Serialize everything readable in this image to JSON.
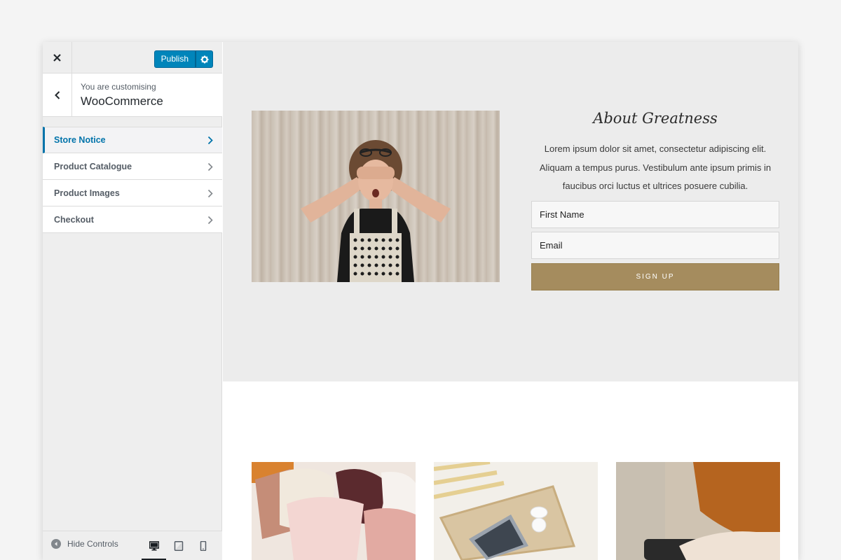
{
  "customizer": {
    "publish_label": "Publish",
    "customizing_label": "You are customising",
    "customizing_title": "WooCommerce",
    "menu": [
      {
        "label": "Store Notice",
        "active": true
      },
      {
        "label": "Product Catalogue",
        "active": false
      },
      {
        "label": "Product Images",
        "active": false
      },
      {
        "label": "Checkout",
        "active": false
      }
    ],
    "hide_controls_label": "Hide Controls",
    "devices": [
      "desktop-icon",
      "tablet-icon",
      "mobile-icon"
    ]
  },
  "preview": {
    "about_title": "About Greatness",
    "about_text": "Lorem ipsum dolor sit amet, consectetur adipiscing elit. Aliquam a tempus purus. Vestibulum ante ipsum primis in faucibus orci luctus et ultrices posuere cubilia.",
    "form": {
      "first_name_placeholder": "First Name",
      "email_placeholder": "Email",
      "signup_label": "SIGN UP"
    }
  },
  "colors": {
    "accent_blue": "#0085ba",
    "signup_gold": "#a58c5e",
    "active_menu": "#0073aa"
  }
}
